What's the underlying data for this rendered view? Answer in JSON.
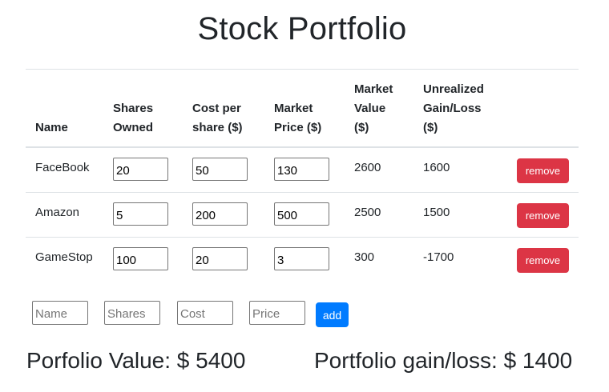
{
  "title": "Stock Portfolio",
  "columns": {
    "name": [
      "Name"
    ],
    "shares": [
      "Shares",
      "Owned"
    ],
    "cost": [
      "Cost per",
      "share ($)"
    ],
    "price": [
      "Market",
      "Price ($)"
    ],
    "value": [
      "Market",
      "Value",
      "($)"
    ],
    "gain": [
      "Unrealized",
      "Gain/Loss",
      "($)"
    ]
  },
  "rows": [
    {
      "name": "FaceBook",
      "shares": "20",
      "cost": "50",
      "price": "130",
      "value": "2600",
      "gain": "1600",
      "remove": "remove"
    },
    {
      "name": "Amazon",
      "shares": "5",
      "cost": "200",
      "price": "500",
      "value": "2500",
      "gain": "1500",
      "remove": "remove"
    },
    {
      "name": "GameStop",
      "shares": "100",
      "cost": "20",
      "price": "3",
      "value": "300",
      "gain": "-1700",
      "remove": "remove"
    }
  ],
  "new_stock": {
    "name_placeholder": "Name",
    "shares_placeholder": "Shares",
    "cost_placeholder": "Cost",
    "price_placeholder": "Price",
    "add_label": "add"
  },
  "summary": {
    "value_text": "Porfolio Value: $ 5400",
    "gain_text": "Portfolio gain/loss: $ 1400"
  },
  "colors": {
    "remove_button": "#dc3545",
    "add_button": "#007bff"
  }
}
